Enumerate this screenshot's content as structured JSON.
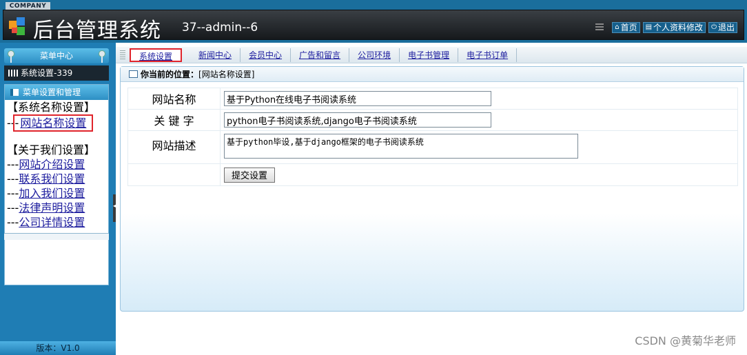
{
  "header": {
    "company": "COMPANY",
    "title": "后台管理系统",
    "user": "37--admin--6",
    "nav": [
      {
        "icon": "home-icon",
        "glyph": "⌂",
        "label": "首页"
      },
      {
        "icon": "profile-icon",
        "glyph": "▤",
        "label": "个人资料修改"
      },
      {
        "icon": "power-icon",
        "glyph": "⏻",
        "label": "退出"
      }
    ]
  },
  "sidebar": {
    "menu_center": "菜单中心",
    "system_block": "系统设置-339",
    "manage_title": "菜单设置和管理",
    "groups": [
      {
        "title": "【系统名称设置】",
        "items": [
          {
            "prefix": "---",
            "label": "网站名称设置"
          }
        ]
      },
      {
        "title": "【关于我们设置】",
        "items": [
          {
            "prefix": "---",
            "label": "网站介绍设置"
          },
          {
            "prefix": "---",
            "label": "联系我们设置"
          },
          {
            "prefix": "---",
            "label": "加入我们设置"
          },
          {
            "prefix": "---",
            "label": "法律声明设置"
          },
          {
            "prefix": "---",
            "label": "公司详情设置"
          }
        ]
      }
    ],
    "version": "版本：V1.0"
  },
  "tabs": [
    "系统设置",
    "新闻中心",
    "会员中心",
    "广告和留言",
    "公司环境",
    "电子书管理",
    "电子书订单"
  ],
  "crumb": {
    "label": "你当前的位置：",
    "value": "[网站名称设置]"
  },
  "form": {
    "site_name_label": "网站名称",
    "site_name_value": "基于Python在线电子书阅读系统",
    "keywords_label": "关 键 字",
    "keywords_value": "python电子书阅读系统,django电子书阅读系统",
    "desc_label": "网站描述",
    "desc_value": "基于python毕设,基于django框架的电子书阅读系统",
    "submit_label": "提交设置"
  },
  "watermark": "CSDN @黄菊华老师",
  "colors": {
    "header_bg": "#1a6e9c",
    "sidebar_bg": "#1f7db4",
    "highlight": "#e0242b",
    "link": "#1c1c9e"
  }
}
